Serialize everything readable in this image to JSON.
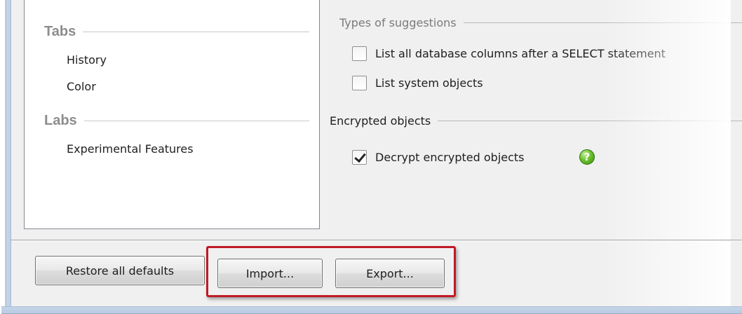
{
  "nav": {
    "groups": [
      {
        "title": "Tabs",
        "items": [
          "History",
          "Color"
        ]
      },
      {
        "title": "Labs",
        "items": [
          "Experimental Features"
        ]
      }
    ]
  },
  "sections": {
    "suggestions": {
      "title": "Types of suggestions",
      "options": [
        {
          "label": "List all database columns after a SELECT statement",
          "checked": false
        },
        {
          "label": "List system objects",
          "checked": false
        }
      ]
    },
    "encrypted": {
      "title": "Encrypted objects",
      "options": [
        {
          "label": "Decrypt encrypted objects",
          "checked": true
        }
      ],
      "help_icon": "?"
    }
  },
  "footer": {
    "restore_label": "Restore all defaults",
    "import_label": "Import...",
    "export_label": "Export..."
  },
  "colors": {
    "highlight": "#c01a25",
    "help_icon": "#4ea51c"
  }
}
